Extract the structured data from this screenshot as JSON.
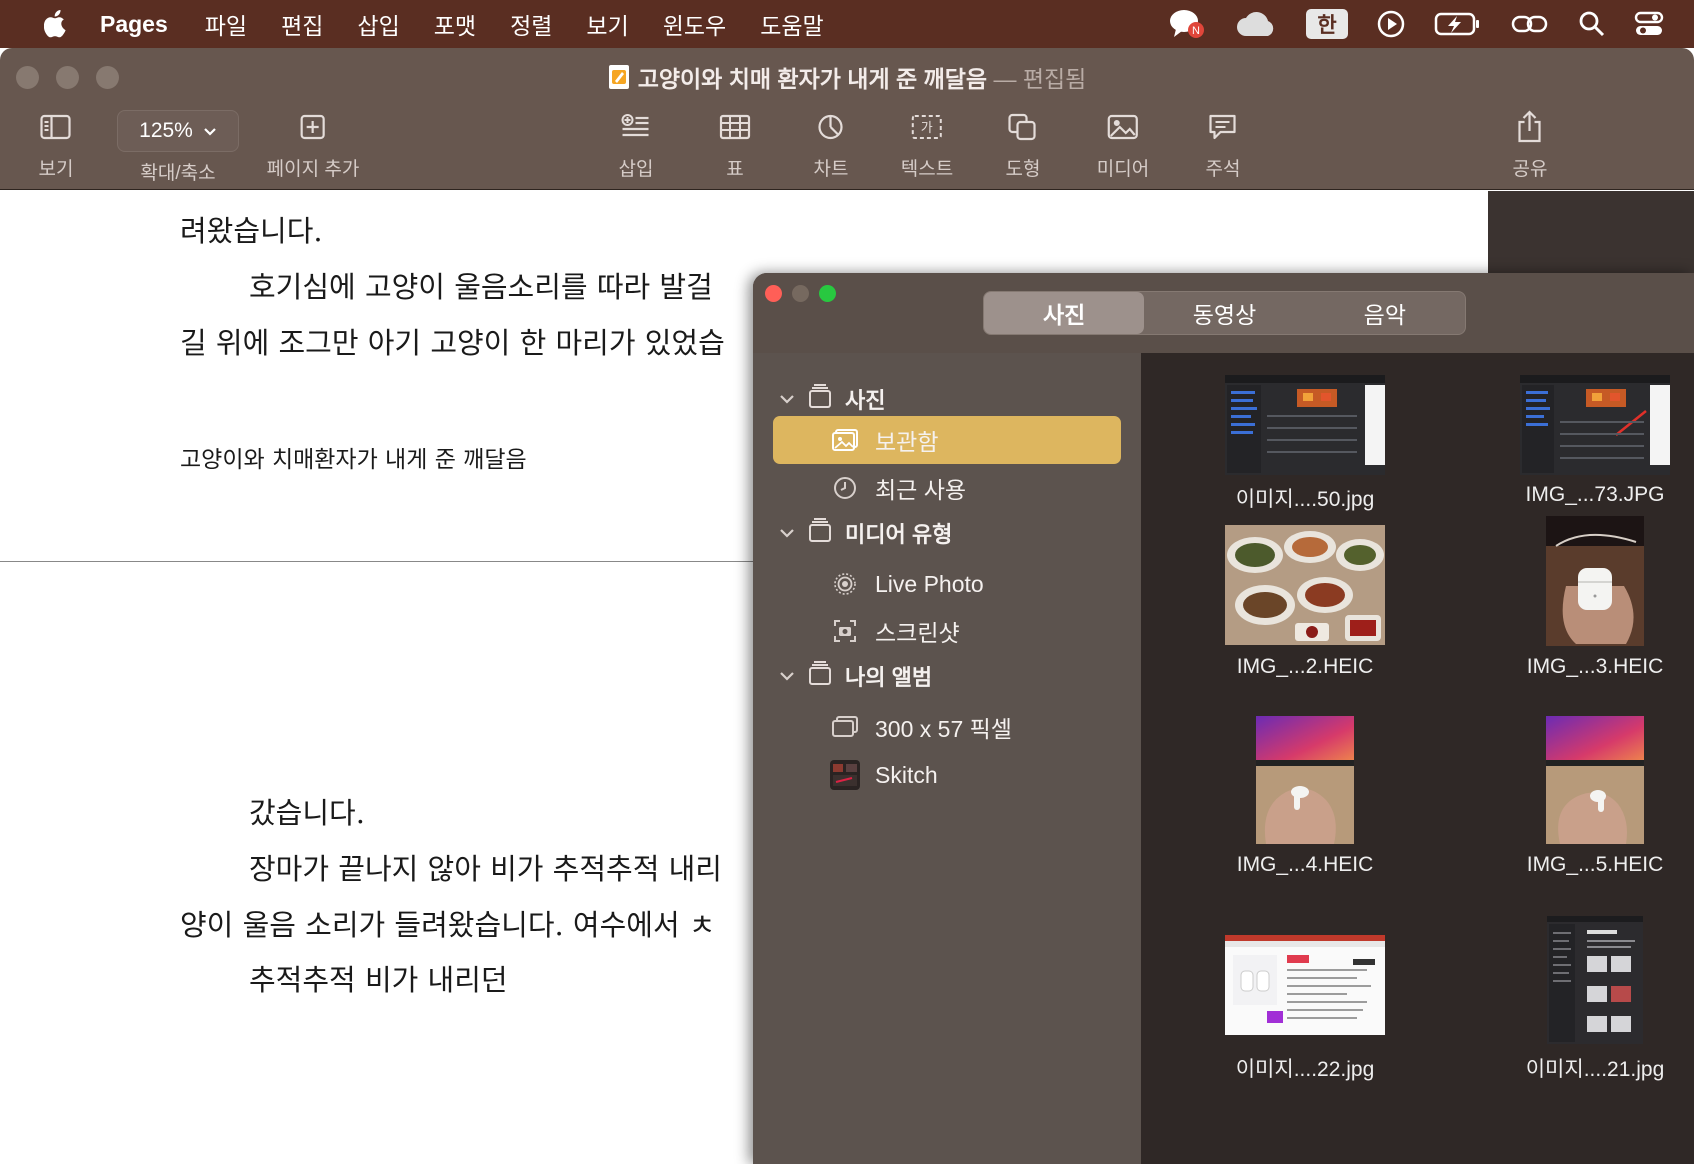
{
  "menubar": {
    "app_name": "Pages",
    "items": [
      "파일",
      "편집",
      "삽입",
      "포맷",
      "정렬",
      "보기",
      "윈도우",
      "도움말"
    ],
    "input_source": "한"
  },
  "window": {
    "title": "고양이와 치매 환자가 내게 준 깨달음",
    "separator": "—",
    "status": "편집됨"
  },
  "toolbar": {
    "view_label": "보기",
    "zoom_value": "125%",
    "zoom_label": "확대/축소",
    "add_page_label": "페이지 추가",
    "insert_label": "삽입",
    "table_label": "표",
    "chart_label": "차트",
    "text_label": "텍스트",
    "shape_label": "도형",
    "media_label": "미디어",
    "comment_label": "주석",
    "share_label": "공유"
  },
  "document": {
    "page1": {
      "line1": "려왔습니다.",
      "line2": "호기심에 고양이 울음소리를 따라 발걸",
      "line3": "길 위에 조그만 아기 고양이 한 마리가 있었습",
      "footer": "고양이와 치매환자가 내게 준 깨달음"
    },
    "page2": {
      "line1": "갔습니다.",
      "line2": "장마가 끝나지 않아 비가 추적추적 내리",
      "line3": "양이 울음 소리가 들려왔습니다. 여수에서 ㅊ",
      "line4": "추적추적 비가 내리던"
    }
  },
  "media_browser": {
    "tabs": [
      "사진",
      "동영상",
      "음악"
    ],
    "selected_tab": "사진",
    "sidebar": {
      "photos_section": "사진",
      "library": "보관함",
      "recent": "최근 사용",
      "media_types_section": "미디어 유형",
      "live_photo": "Live Photo",
      "screenshots": "스크린샷",
      "my_albums_section": "나의 앨범",
      "album_300x57": "300 x 57 픽셀",
      "album_skitch": "Skitch"
    },
    "items": [
      {
        "name": "이미지....50.jpg",
        "kind": "screenshot"
      },
      {
        "name": "IMG_...73.JPG",
        "kind": "screenshot"
      },
      {
        "name": "IMG_...2.HEIC",
        "kind": "food"
      },
      {
        "name": "IMG_...3.HEIC",
        "kind": "airpods-case"
      },
      {
        "name": "IMG_...4.HEIC",
        "kind": "airpod"
      },
      {
        "name": "IMG_...5.HEIC",
        "kind": "airpod"
      },
      {
        "name": "이미지....22.jpg",
        "kind": "web-page"
      },
      {
        "name": "이미지....21.jpg",
        "kind": "dark-screenshot"
      }
    ]
  },
  "colors": {
    "menubar": "#5a2e22",
    "toolbar": "#67574f",
    "sidebar_selection": "#ddb65f",
    "close": "#ff5f57",
    "minimize": "#febc2e",
    "zoom": "#28c840"
  }
}
